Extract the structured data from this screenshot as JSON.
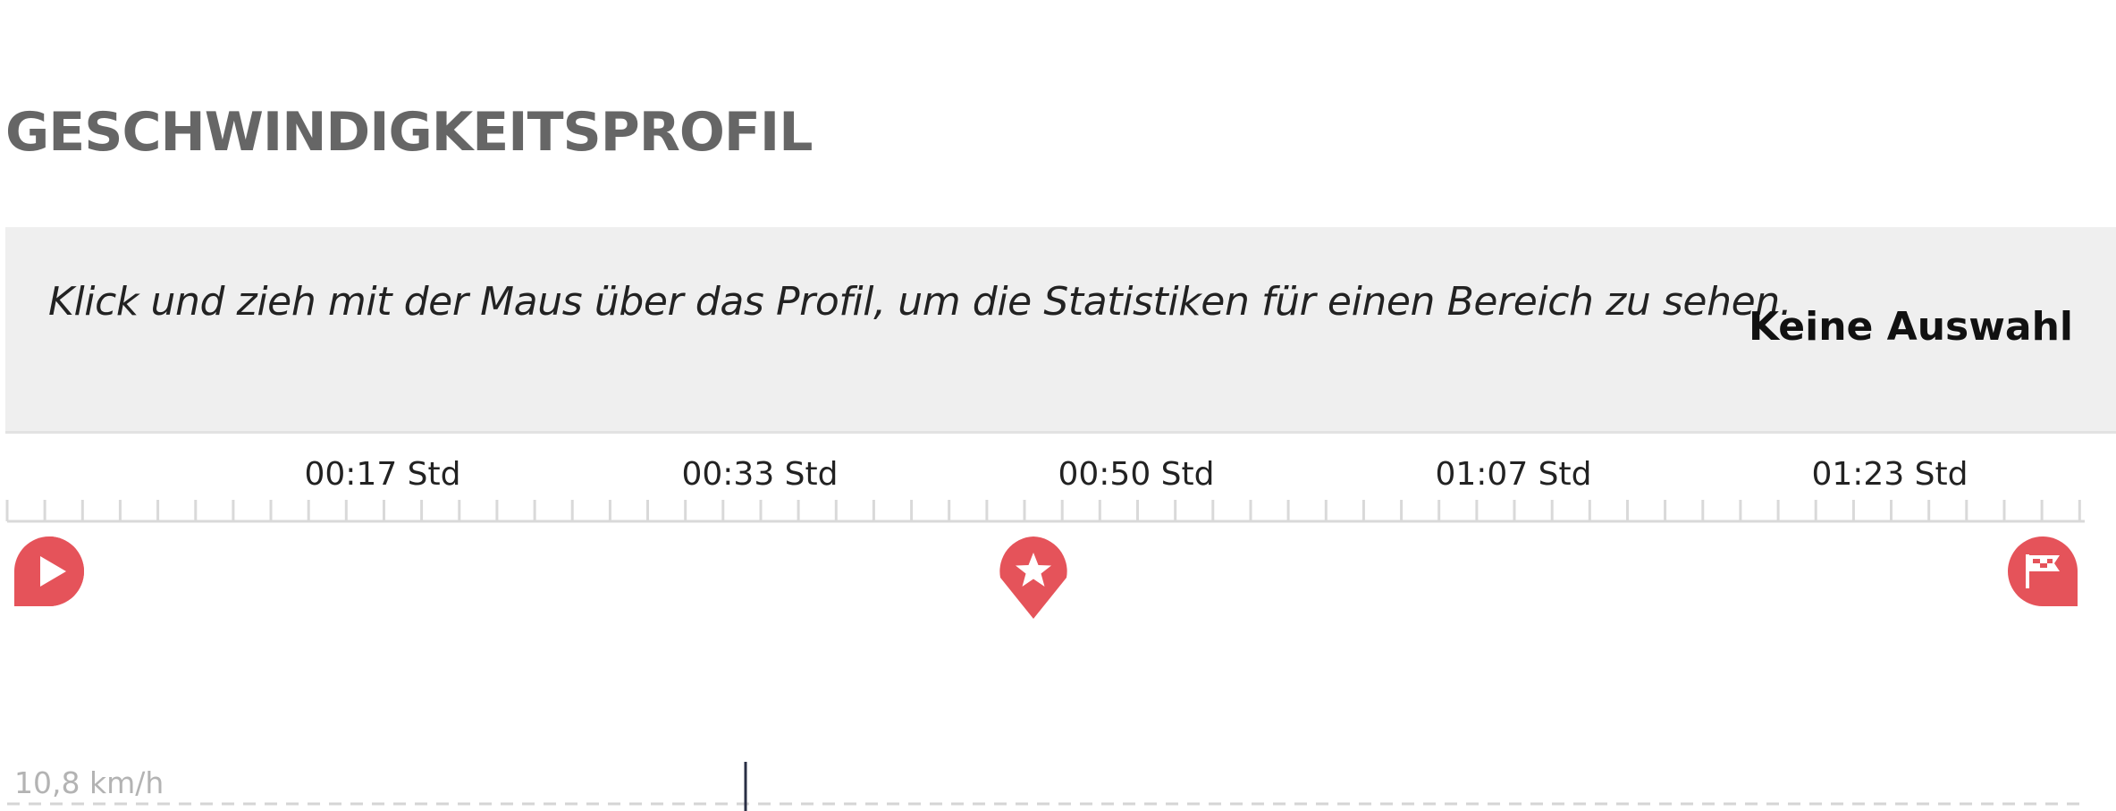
{
  "section": {
    "title": "GESCHWINDIGKEITSPROFIL"
  },
  "info": {
    "hint": "Klick und zieh mit der Maus über das Profil, um die Statistiken für einen Bereich zu sehen.",
    "selection_status": "Keine Auswahl"
  },
  "timeline": {
    "labels": [
      "00:17 Std",
      "00:33 Std",
      "00:50 Std",
      "01:07 Std",
      "01:23 Std"
    ]
  },
  "markers": {
    "start_icon": "play-icon",
    "highlight_icon": "star-icon",
    "finish_icon": "flag-icon",
    "color": "#e5535a"
  },
  "chart": {
    "speed_label": "10,8 km/h"
  }
}
